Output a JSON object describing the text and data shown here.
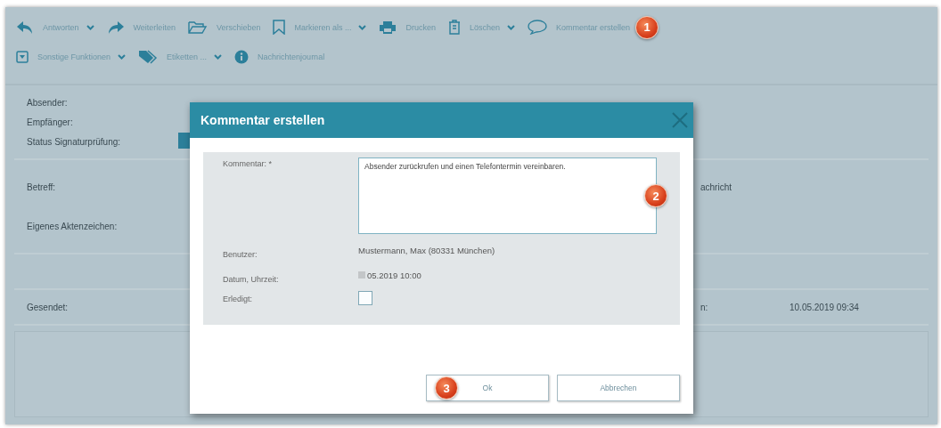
{
  "toolbar": {
    "primary_actions": [
      {
        "label": "Antworten",
        "dropdown": true
      },
      {
        "label": "Weiterleiten",
        "dropdown": false
      },
      {
        "label": "Verschieben",
        "dropdown": false
      },
      {
        "label": "Markieren als ...",
        "dropdown": true
      },
      {
        "label": "Drucken",
        "dropdown": false
      },
      {
        "label": "Löschen",
        "dropdown": true
      },
      {
        "label": "Kommentar erstellen",
        "dropdown": false,
        "callout": "1"
      }
    ],
    "more_actions": [
      {
        "label": "Sonstige Funktionen",
        "dropdown": true
      },
      {
        "label": "Etiketten ...",
        "dropdown": true
      },
      {
        "label": "Nachrichtenjournal",
        "dropdown": false
      }
    ]
  },
  "details": [
    {
      "rows": [
        {
          "label": "Absender:"
        },
        {
          "label": "Empfänger:"
        },
        {
          "label": "Status Signaturprüfung:",
          "indicator": true
        }
      ]
    },
    {
      "rows": [
        {
          "label": "Betreff:",
          "right_label": "achricht"
        },
        {
          "label": "Eigenes Aktenzeichen:"
        }
      ]
    },
    {
      "rows": [
        {
          "label": "Gesendet:",
          "right_label": "n:",
          "right_value": "10.05.2019 09:34"
        }
      ]
    }
  ],
  "dialog": {
    "title": "Kommentar erstellen",
    "comment": {
      "label": "Kommentar: *",
      "value": "Absender zurückrufen und einen Telefontermin vereinbaren.",
      "callout": "2"
    },
    "user": {
      "label": "Benutzer:",
      "value": "Mustermann, Max (80331 München)"
    },
    "datetime": {
      "label": "Datum, Uhrzeit:",
      "value": "05.2019 10:00"
    },
    "done": {
      "label": "Erledigt:",
      "checked": false
    },
    "buttons": [
      {
        "label": "Ok",
        "callout": "3"
      },
      {
        "label": "Abbrechen"
      }
    ]
  }
}
